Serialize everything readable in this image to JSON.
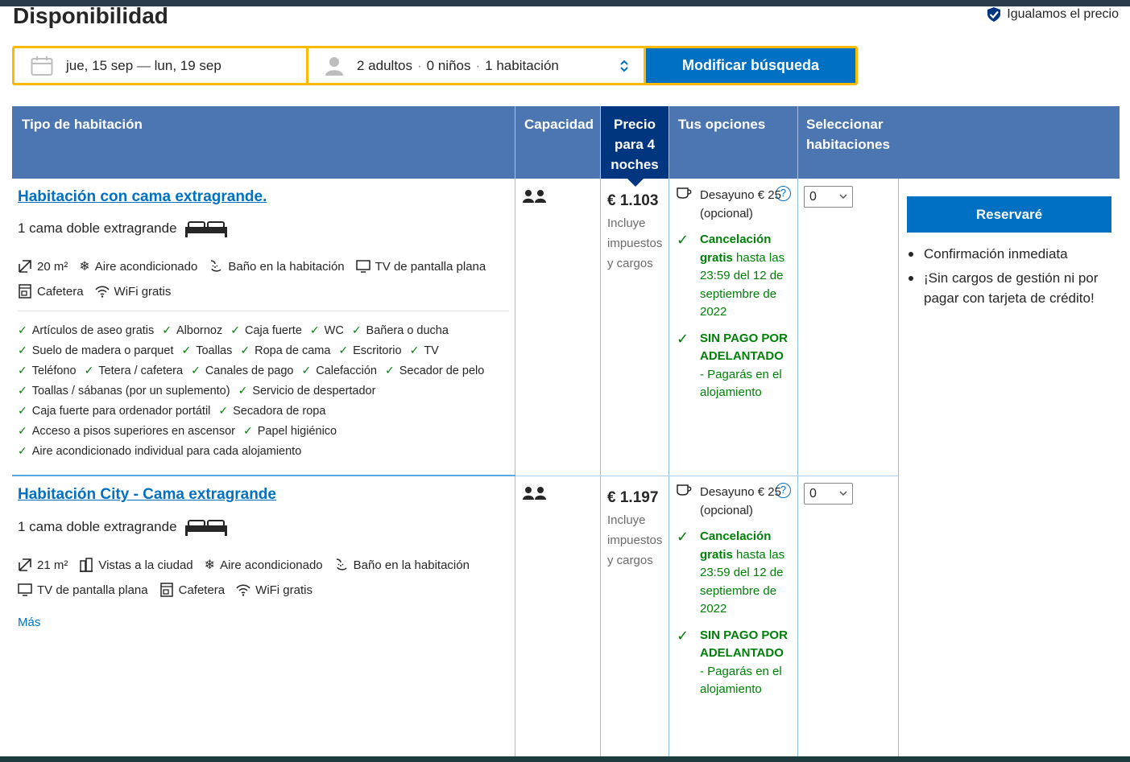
{
  "page_title": "Disponibilidad",
  "price_match": "Igualamos el precio",
  "search": {
    "date_from": "jue, 15 sep",
    "date_to": "lun, 19 sep",
    "adults": "2 adultos",
    "children": "0 niños",
    "rooms": "1 habitación",
    "button": "Modificar búsqueda"
  },
  "table_header": {
    "type": "Tipo de habitación",
    "capacity": "Capacidad",
    "price": "Precio para 4 noches",
    "options": "Tus opciones",
    "select": "Seleccionar habitaciones"
  },
  "rooms": [
    {
      "name": "Habitación con cama extragrande.",
      "bed": "1 cama doble extragrande",
      "facilities": [
        {
          "icon": "room-size-icon",
          "label": "20 m²"
        },
        {
          "icon": "snowflake-icon",
          "label": "Aire acondicionado"
        },
        {
          "icon": "bath-icon",
          "label": "Baño en la habitación"
        },
        {
          "icon": "tv-icon",
          "label": "TV de pantalla plana"
        },
        {
          "icon": "coffee-machine-icon",
          "label": "Cafetera"
        },
        {
          "icon": "wifi-icon",
          "label": "WiFi gratis"
        }
      ],
      "amenities": [
        "Artículos de aseo gratis",
        "Albornoz",
        "Caja fuerte",
        "WC",
        "Bañera o ducha",
        "Suelo de madera o parquet",
        "Toallas",
        "Ropa de cama",
        "Escritorio",
        "TV",
        "Teléfono",
        "Tetera / cafetera",
        "Canales de pago",
        "Calefacción",
        "Secador de pelo",
        "Toallas / sábanas (por un suplemento)",
        "Servicio de despertador",
        "Caja fuerte para ordenador portátil",
        "Secadora de ropa",
        "Acceso a pisos superiores en ascensor",
        "Papel higiénico",
        "Aire acondicionado individual para cada alojamiento"
      ],
      "price": "€ 1.103",
      "price_note": "Incluye impuestos y cargos",
      "options": {
        "breakfast": "Desayuno € 25 (opcional)",
        "cancel_bold": "Cancelación gratis",
        "cancel_rest": "hasta las 23:59 del 12 de septiembre de 2022",
        "nopay_bold": "SIN PAGO POR ADELANTADO",
        "nopay_rest": "- Pagarás en el alojamiento"
      },
      "select_value": "0"
    },
    {
      "name": "Habitación City - Cama extragrande",
      "bed": "1 cama doble extragrande",
      "facilities": [
        {
          "icon": "room-size-icon",
          "label": "21 m²"
        },
        {
          "icon": "city-icon",
          "label": "Vistas a la ciudad"
        },
        {
          "icon": "snowflake-icon",
          "label": "Aire acondicionado"
        },
        {
          "icon": "bath-icon",
          "label": "Baño en la habitación"
        },
        {
          "icon": "tv-icon",
          "label": "TV de pantalla plana"
        },
        {
          "icon": "coffee-machine-icon",
          "label": "Cafetera"
        },
        {
          "icon": "wifi-icon",
          "label": "WiFi gratis"
        }
      ],
      "more": "Más",
      "price": "€ 1.197",
      "price_note": "Incluye impuestos y cargos",
      "options": {
        "breakfast": "Desayuno € 25 (opcional)",
        "cancel_bold": "Cancelación gratis",
        "cancel_rest": "hasta las 23:59 del 12 de septiembre de 2022",
        "nopay_bold": "SIN PAGO POR ADELANTADO",
        "nopay_rest": "- Pagarás en el alojamiento"
      },
      "select_value": "0"
    }
  ],
  "reserve": {
    "button": "Reservaré",
    "bullets": [
      "Confirmación inmediata",
      "¡Sin cargos de gestión ni por pagar con tarjeta de crédito!"
    ]
  },
  "colors": {
    "brand_blue": "#0071c2",
    "header_blue": "#4c76b2",
    "dark_blue": "#003580",
    "accent_yellow": "#febb02",
    "green": "#008009"
  }
}
